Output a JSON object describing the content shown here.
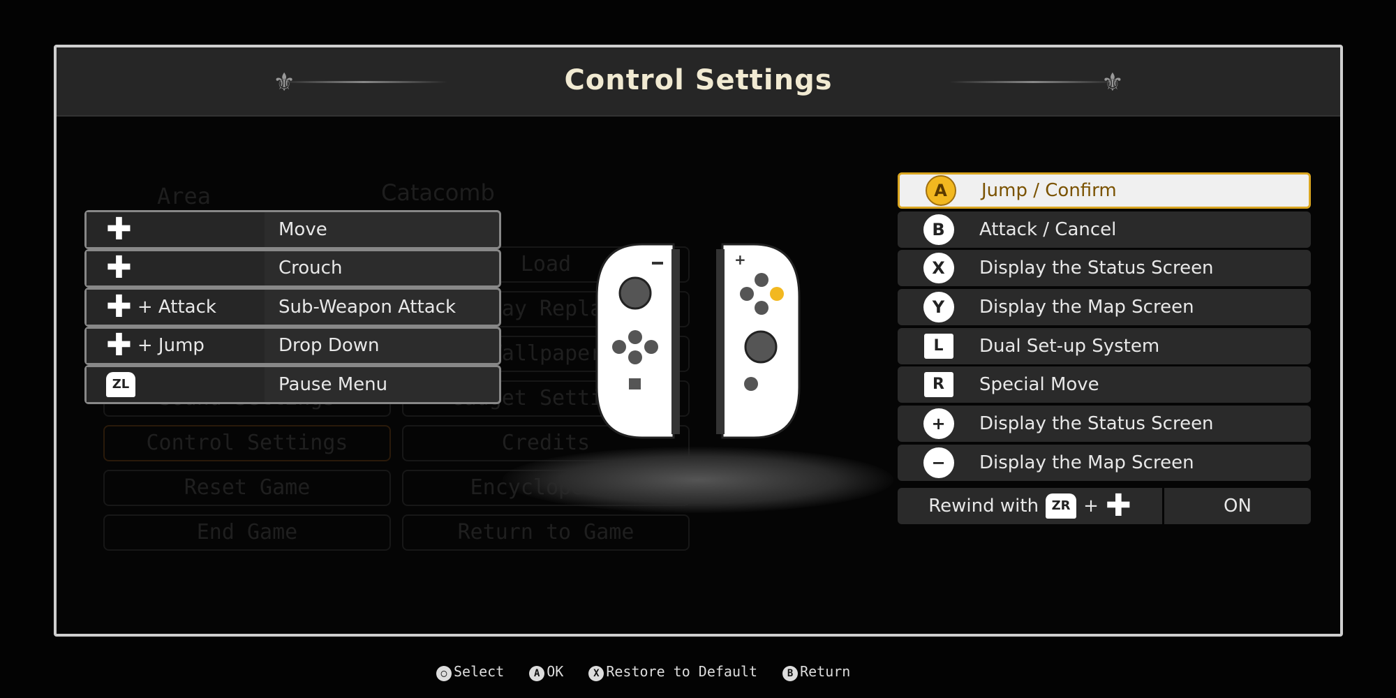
{
  "title": "Control Settings",
  "background_menu": {
    "area_label": "Area",
    "area_value": "Catacomb",
    "buttons": [
      "Load",
      "Play Replay",
      "Wallpaper",
      "Sound Settings",
      "Gadget Settings",
      "Control Settings",
      "Credits",
      "Reset Game",
      "Encyclopedia",
      "End Game",
      "Return to Game"
    ]
  },
  "left_bindings": [
    {
      "icon": "dpad-icon",
      "modifier": "",
      "action": "Move"
    },
    {
      "icon": "dpad-down-icon",
      "modifier": "",
      "action": "Crouch"
    },
    {
      "icon": "dpad-up-icon",
      "modifier": "+ Attack",
      "action": "Sub-Weapon Attack"
    },
    {
      "icon": "dpad-down-icon",
      "modifier": "+ Jump",
      "action": "Drop Down"
    },
    {
      "icon": "zl-button-icon",
      "key": "ZL",
      "modifier": "",
      "action": "Pause Menu"
    }
  ],
  "right_bindings": [
    {
      "key": "A",
      "shape": "circle",
      "action": "Jump / Confirm",
      "selected": true
    },
    {
      "key": "B",
      "shape": "circle",
      "action": "Attack / Cancel"
    },
    {
      "key": "X",
      "shape": "circle",
      "action": "Display the Status Screen"
    },
    {
      "key": "Y",
      "shape": "circle",
      "action": "Display the Map Screen"
    },
    {
      "key": "L",
      "shape": "square",
      "action": "Dual Set-up System"
    },
    {
      "key": "R",
      "shape": "square",
      "action": "Special Move"
    },
    {
      "key": "+",
      "shape": "circle",
      "action": "Display the Status Screen"
    },
    {
      "key": "−",
      "shape": "circle",
      "action": "Display the Map Screen"
    }
  ],
  "rewind": {
    "label": "Rewind with",
    "key": "ZR",
    "plus": "+",
    "value": "ON"
  },
  "footer": [
    {
      "key": "◯",
      "label": "Select"
    },
    {
      "key": "A",
      "label": "OK"
    },
    {
      "key": "X",
      "label": "Restore to Default"
    },
    {
      "key": "B",
      "label": "Return"
    }
  ],
  "colors": {
    "accent": "#f2b820",
    "selected_bg": "#f0f0f0",
    "row_bg": "#2a2a2a"
  }
}
